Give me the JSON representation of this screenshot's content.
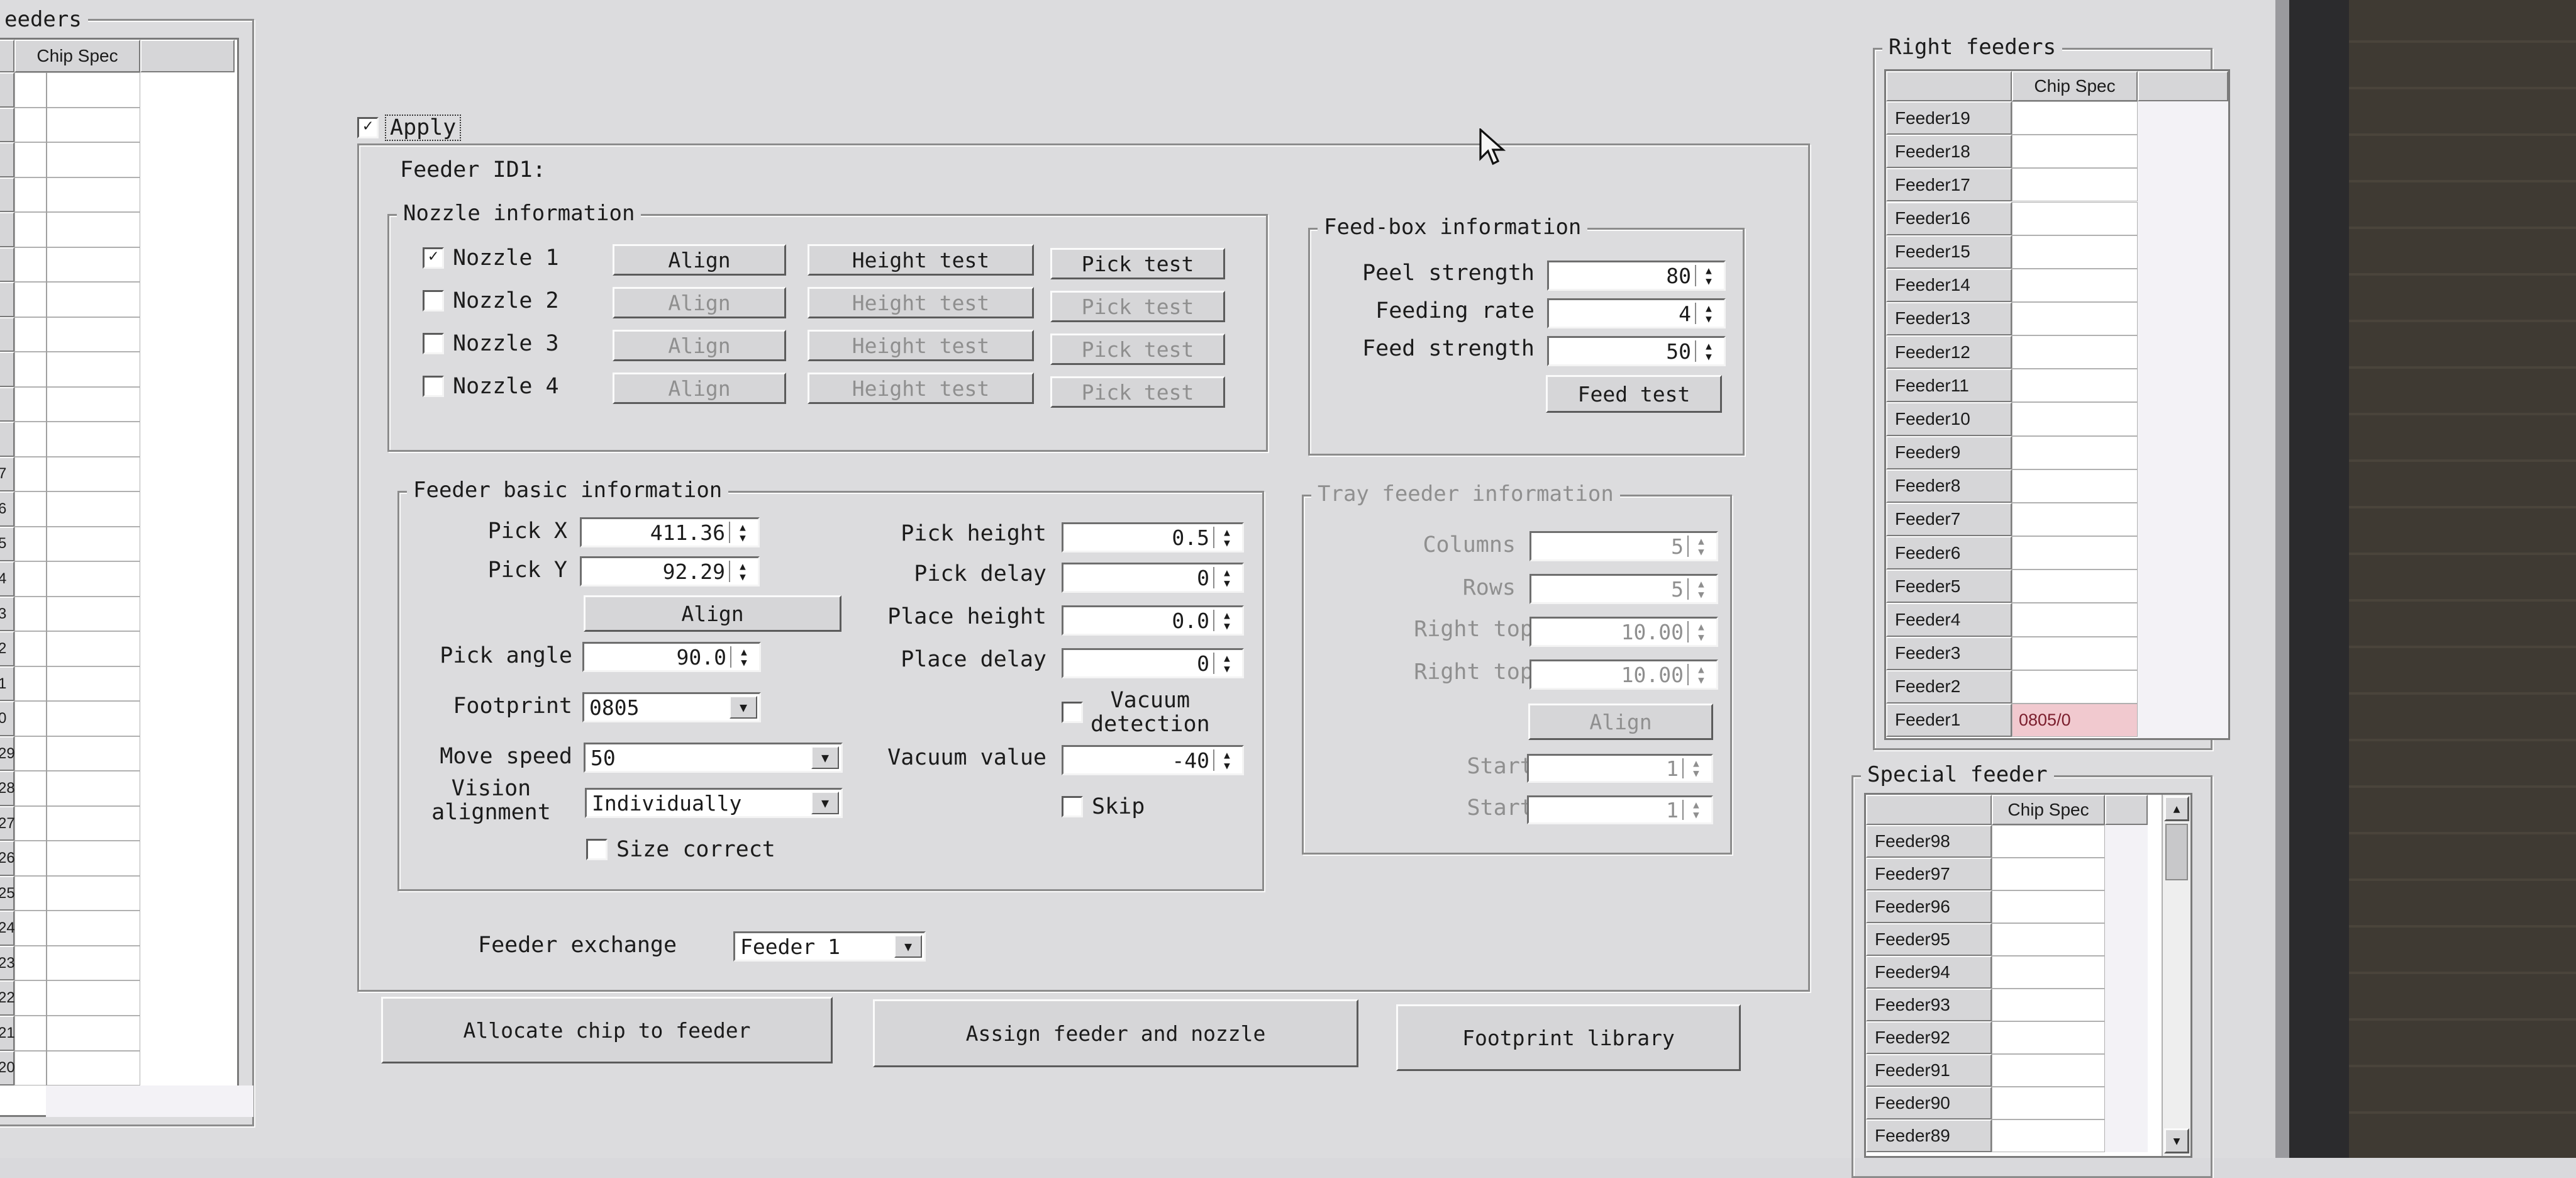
{
  "left_panel": {
    "title": "eeders",
    "column_header": "Chip Spec",
    "row_labels": [
      "",
      "",
      "",
      "",
      "",
      "",
      "",
      "",
      "",
      "",
      "",
      "7",
      "6",
      "5",
      "4",
      "3",
      "2",
      "1",
      "0",
      "29",
      "28",
      "27",
      "26",
      "25",
      "24",
      "23",
      "22",
      "21",
      "20"
    ]
  },
  "apply": {
    "checked": true,
    "label": "Apply"
  },
  "feeder_id_label": "Feeder ID1:",
  "nozzle_info": {
    "title": "Nozzle information",
    "rows": [
      {
        "label": "Nozzle 1",
        "checked": true,
        "enabled": true,
        "align": "Align",
        "height": "Height test",
        "pick": "Pick test"
      },
      {
        "label": "Nozzle 2",
        "checked": false,
        "enabled": false,
        "align": "Align",
        "height": "Height test",
        "pick": "Pick test"
      },
      {
        "label": "Nozzle 3",
        "checked": false,
        "enabled": false,
        "align": "Align",
        "height": "Height test",
        "pick": "Pick test"
      },
      {
        "label": "Nozzle 4",
        "checked": false,
        "enabled": false,
        "align": "Align",
        "height": "Height test",
        "pick": "Pick test"
      }
    ]
  },
  "feedbox": {
    "title": "Feed-box information",
    "peel_strength": {
      "label": "Peel strength",
      "value": "80"
    },
    "feeding_rate": {
      "label": "Feeding rate",
      "value": "4"
    },
    "feed_strength": {
      "label": "Feed strength",
      "value": "50"
    },
    "feed_test": "Feed test"
  },
  "basic": {
    "title": "Feeder basic information",
    "pick_x": {
      "label": "Pick X",
      "value": "411.36"
    },
    "pick_y": {
      "label": "Pick Y",
      "value": "92.29"
    },
    "align": "Align",
    "pick_angle": {
      "label": "Pick angle",
      "value": "90.0"
    },
    "footprint": {
      "label": "Footprint",
      "value": "0805"
    },
    "move_speed": {
      "label": "Move speed",
      "value": "50"
    },
    "vision_alignment": {
      "label1": "Vision",
      "label2": "alignment",
      "value": "Individually"
    },
    "size_correct": {
      "label": "Size correct",
      "checked": false
    },
    "pick_height": {
      "label": "Pick height",
      "value": "0.5"
    },
    "pick_delay": {
      "label": "Pick delay",
      "value": "0"
    },
    "place_height": {
      "label": "Place height",
      "value": "0.0"
    },
    "place_delay": {
      "label": "Place delay",
      "value": "0"
    },
    "vacuum_detection": {
      "label1": "Vacuum",
      "label2": "detection",
      "checked": false
    },
    "vacuum_value": {
      "label": "Vacuum value",
      "value": "-40"
    },
    "skip": {
      "label": "Skip",
      "checked": false
    }
  },
  "tray": {
    "title": "Tray feeder information",
    "columns": {
      "label": "Columns",
      "value": "5"
    },
    "rows": {
      "label": "Rows",
      "value": "5"
    },
    "right_top_x": {
      "label": "Right top X",
      "value": "10.00"
    },
    "right_top_y": {
      "label": "Right top Y",
      "value": "10.00"
    },
    "align": "Align",
    "start_x": {
      "label": "Start X",
      "value": "1"
    },
    "start_y": {
      "label": "Start Y",
      "value": "1"
    }
  },
  "feeder_exchange": {
    "label": "Feeder exchange",
    "value": "Feeder 1"
  },
  "bottom_buttons": {
    "allocate": "Allocate chip to feeder",
    "assign": "Assign feeder and nozzle",
    "footprint_library": "Footprint library"
  },
  "right_feeders": {
    "title": "Right feeders",
    "column_header": "Chip Spec",
    "rows": [
      {
        "name": "Feeder19",
        "spec": ""
      },
      {
        "name": "Feeder18",
        "spec": ""
      },
      {
        "name": "Feeder17",
        "spec": ""
      },
      {
        "name": "Feeder16",
        "spec": ""
      },
      {
        "name": "Feeder15",
        "spec": ""
      },
      {
        "name": "Feeder14",
        "spec": ""
      },
      {
        "name": "Feeder13",
        "spec": ""
      },
      {
        "name": "Feeder12",
        "spec": ""
      },
      {
        "name": "Feeder11",
        "spec": ""
      },
      {
        "name": "Feeder10",
        "spec": ""
      },
      {
        "name": "Feeder9",
        "spec": ""
      },
      {
        "name": "Feeder8",
        "spec": ""
      },
      {
        "name": "Feeder7",
        "spec": ""
      },
      {
        "name": "Feeder6",
        "spec": ""
      },
      {
        "name": "Feeder5",
        "spec": ""
      },
      {
        "name": "Feeder4",
        "spec": ""
      },
      {
        "name": "Feeder3",
        "spec": ""
      },
      {
        "name": "Feeder2",
        "spec": ""
      },
      {
        "name": "Feeder1",
        "spec": "0805/0"
      }
    ],
    "highlight_color": "#f1c9cf"
  },
  "special_feeder": {
    "title": "Special feeder",
    "column_header": "Chip Spec",
    "rows": [
      "Feeder98",
      "Feeder97",
      "Feeder96",
      "Feeder95",
      "Feeder94",
      "Feeder93",
      "Feeder92",
      "Feeder91",
      "Feeder90",
      "Feeder89"
    ]
  },
  "icons": {
    "checkbox_checked": "✓",
    "spin_up": "▲",
    "spin_down": "▼",
    "dropdown": "▼",
    "cursor": "mouse-pointer-icon"
  }
}
